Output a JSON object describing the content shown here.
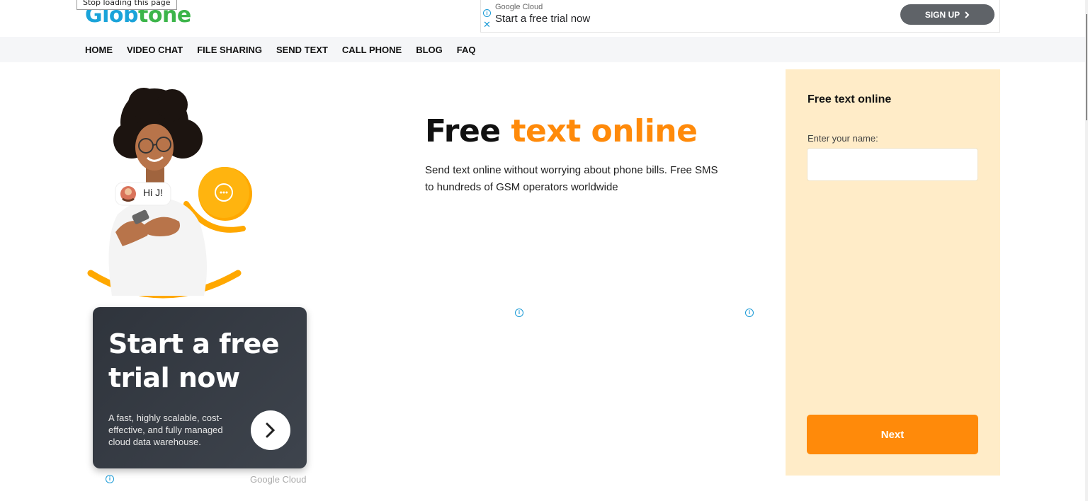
{
  "header": {
    "tooltip": "Stop loading this page",
    "logo": {
      "part1": "Glo",
      "part2": "b",
      "part3": "tone"
    }
  },
  "top_ad": {
    "source": "Google Cloud",
    "title": "Start a free trial now",
    "cta": "SIGN UP"
  },
  "nav": {
    "items": [
      {
        "label": "HOME"
      },
      {
        "label": "VIDEO CHAT"
      },
      {
        "label": "FILE SHARING"
      },
      {
        "label": "SEND TEXT"
      },
      {
        "label": "CALL PHONE"
      },
      {
        "label": "BLOG"
      },
      {
        "label": "FAQ"
      }
    ]
  },
  "hero": {
    "chat_bubble": "Hi J!"
  },
  "ad_card": {
    "headline": "Start a free trial now",
    "description": "A fast, highly scalable, cost-effective, and fully managed cloud data warehouse.",
    "source": "Google Cloud"
  },
  "main": {
    "title_part1": "Free ",
    "title_part2": "text online",
    "description": "Send text online without worrying about phone bills. Free SMS to hundreds of GSM operators worldwide"
  },
  "form_panel": {
    "title": "Free text online",
    "name_label": "Enter your name:",
    "name_value": "",
    "next_label": "Next"
  },
  "colors": {
    "accent_orange": "#ff8a0a",
    "panel_bg": "#ffecc8",
    "logo_blue": "#1aa3d9",
    "logo_green": "#3cb54a",
    "nav_bg": "#f5f6f8"
  }
}
